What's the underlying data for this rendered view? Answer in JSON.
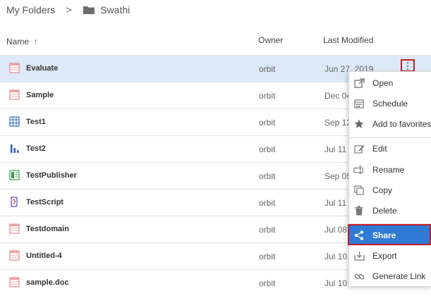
{
  "breadcrumb": {
    "root": "My Folders",
    "separator": ">",
    "current": "Swathi"
  },
  "header": {
    "name": "Name",
    "owner": "Owner",
    "last_modified": "Last Modified"
  },
  "rows": [
    {
      "name": "Evaluate",
      "owner": "orbit",
      "modified": "Jun 27, 2019",
      "icon": "report-icon",
      "selected": true
    },
    {
      "name": "Sample",
      "owner": "orbit",
      "modified": "Dec 04",
      "icon": "report-icon"
    },
    {
      "name": "Test1",
      "owner": "orbit",
      "modified": "Sep 12",
      "icon": "grid-icon"
    },
    {
      "name": "Test2",
      "owner": "orbit",
      "modified": "Jul 11",
      "icon": "bar-chart-icon"
    },
    {
      "name": "TestPublisher",
      "owner": "orbit",
      "modified": "Sep 05",
      "icon": "publisher-icon"
    },
    {
      "name": "TestScript",
      "owner": "orbit",
      "modified": "Jul 11",
      "icon": "script-icon"
    },
    {
      "name": "Testdomain",
      "owner": "orbit",
      "modified": "Jul 08",
      "icon": "report-icon"
    },
    {
      "name": "Untitled-4",
      "owner": "orbit",
      "modified": "Jul 10",
      "icon": "report-icon"
    },
    {
      "name": "sample.doc",
      "owner": "orbit",
      "modified": "Jul 10",
      "icon": "report-icon"
    }
  ],
  "menu": {
    "open": "Open",
    "schedule": "Schedule",
    "add_to_favorites": "Add to favorites",
    "edit": "Edit",
    "rename": "Rename",
    "copy": "Copy",
    "delete": "Delete",
    "share": "Share",
    "export": "Export",
    "generate_link": "Generate Link"
  },
  "colors": {
    "selected_row": "#dde9f7",
    "share_highlight": "#2f7ad6",
    "red_outline": "#c0202a"
  }
}
